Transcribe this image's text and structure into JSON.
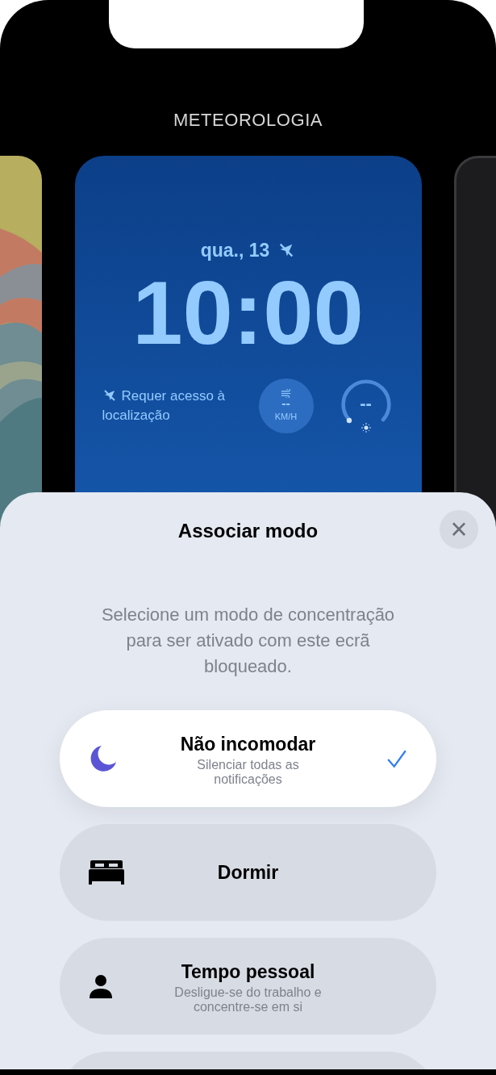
{
  "carousel": {
    "title": "METEOROLOGIA",
    "lock_screen": {
      "date": "qua., 13",
      "time": "10:00",
      "location_notice": "Requer acesso à localização",
      "wind": {
        "value": "--",
        "unit": "KM/H"
      },
      "uv": {
        "value": "--"
      }
    }
  },
  "sheet": {
    "title": "Associar modo",
    "close": "×",
    "description": "Selecione um modo de concentração para ser ativado com este ecrã bloqueado.",
    "modes": [
      {
        "kind": "moon",
        "name": "Não incomodar",
        "subtitle": "Silenciar todas as notificações",
        "selected": true
      },
      {
        "kind": "bed",
        "name": "Dormir",
        "selected": false
      },
      {
        "kind": "person",
        "name": "Tempo pessoal",
        "subtitle": "Desligue-se do trabalho e concentre-se em si",
        "selected": false
      }
    ]
  }
}
